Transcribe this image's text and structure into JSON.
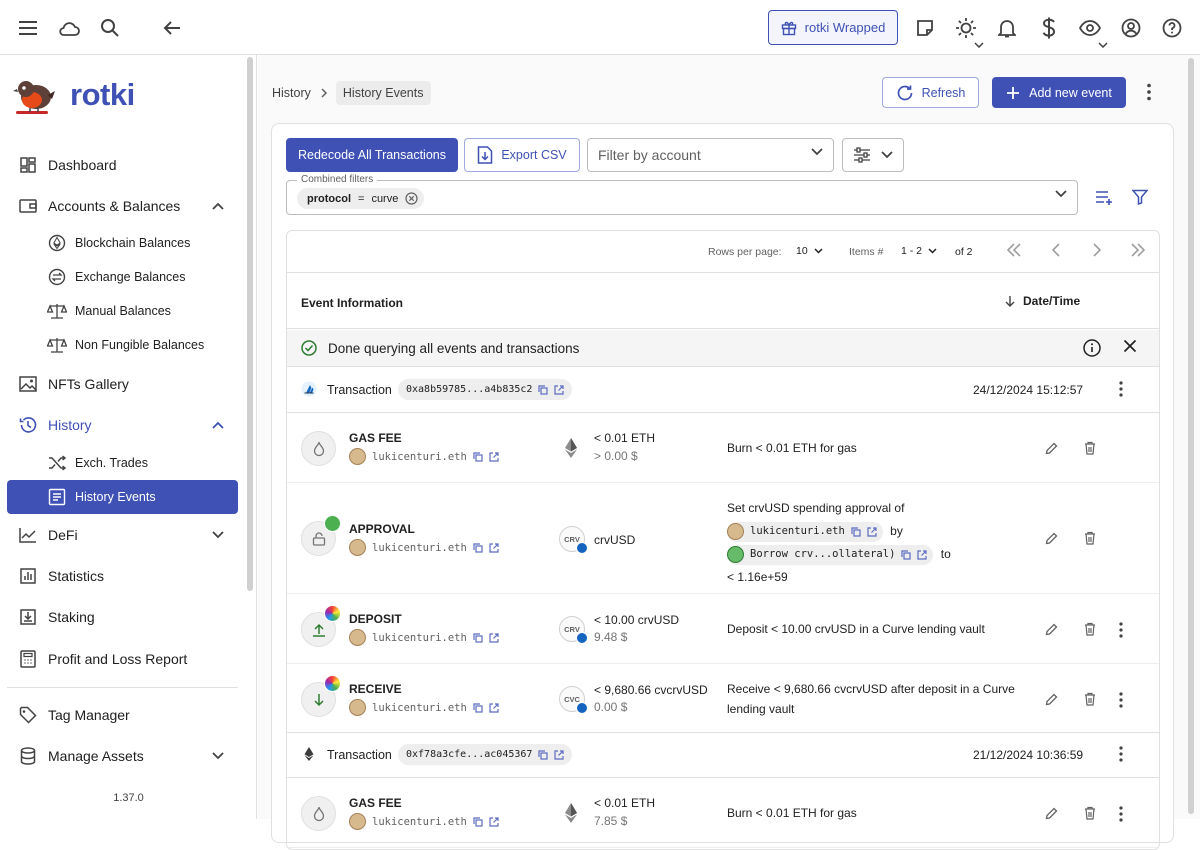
{
  "topbar": {
    "menu_icon": "menu-icon",
    "cloud_icon": "cloud-icon",
    "search_icon": "search-icon",
    "back_icon": "arrow-left-icon",
    "wrapped_label": "rotki Wrapped",
    "right_icons": [
      "notes-icon",
      "theme-icon",
      "bell-icon",
      "dollar-icon",
      "eye-icon",
      "account-icon",
      "help-icon"
    ]
  },
  "sidebar": {
    "app_name": "rotki",
    "items": {
      "dashboard": "Dashboard",
      "accounts": "Accounts & Balances",
      "blockchain": "Blockchain Balances",
      "exchange": "Exchange Balances",
      "manual": "Manual Balances",
      "nft_bal": "Non Fungible Balances",
      "nfts": "NFTs Gallery",
      "history": "History",
      "exch_trades": "Exch. Trades",
      "history_events": "History Events",
      "defi": "DeFi",
      "statistics": "Statistics",
      "staking": "Staking",
      "pnl": "Profit and Loss Report",
      "tags": "Tag Manager",
      "assets": "Manage Assets"
    },
    "version": "1.37.0"
  },
  "main": {
    "breadcrumb": {
      "parent": "History",
      "current": "History Events"
    },
    "refresh_label": "Refresh",
    "add_label": "Add new event",
    "redecode_label": "Redecode All Transactions",
    "export_label": "Export CSV",
    "account_placeholder": "Filter by account",
    "filters_label": "Combined filters",
    "filter_chip": {
      "key": "protocol",
      "op": "=",
      "value": "curve"
    },
    "pager": {
      "rows_label": "Rows per page:",
      "rows_value": "10",
      "items_label": "Items #",
      "items_value": "1 - 2",
      "of_label": "of 2"
    },
    "table_headers": {
      "info": "Event Information",
      "date": "Date/Time"
    },
    "alert": "Done querying all events and transactions",
    "transactions": [
      {
        "label": "Transaction",
        "hash": "0xa8b59785...a4b835c2",
        "date": "24/12/2024 15:12:57",
        "events": [
          {
            "type": "GAS FEE",
            "account": "lukicenturi.eth",
            "amount": "< 0.01 ETH",
            "usd": "> 0.00 $",
            "description": "Burn < 0.01 ETH for gas"
          },
          {
            "type": "APPROVAL",
            "account": "lukicenturi.eth",
            "asset_abbr": "CRV",
            "asset": "crvUSD",
            "desc_prefix": "Set crvUSD spending approval of",
            "desc_account": "lukicenturi.eth",
            "desc_by": "by",
            "desc_spender": "Borrow crv...ollateral)",
            "desc_to": "to",
            "desc_amount": "< 1.16e+59"
          },
          {
            "type": "DEPOSIT",
            "account": "lukicenturi.eth",
            "asset_abbr": "CRV",
            "amount": "< 10.00 crvUSD",
            "usd": "9.48 $",
            "description": "Deposit < 10.00 crvUSD in a Curve lending vault"
          },
          {
            "type": "RECEIVE",
            "account": "lukicenturi.eth",
            "asset_abbr": "CVC",
            "amount": "< 9,680.66 cvcrvUSD",
            "usd": "0.00 $",
            "description": "Receive < 9,680.66 cvcrvUSD after deposit in a Curve lending vault"
          }
        ]
      },
      {
        "label": "Transaction",
        "hash": "0xf78a3cfe...ac045367",
        "date": "21/12/2024 10:36:59",
        "events": [
          {
            "type": "GAS FEE",
            "account": "lukicenturi.eth",
            "amount": "< 0.01 ETH",
            "usd": "7.85 $",
            "description": "Burn < 0.01 ETH for gas"
          }
        ]
      }
    ]
  },
  "colors": {
    "primary": "#3f51b5",
    "success": "#2e7d32"
  }
}
